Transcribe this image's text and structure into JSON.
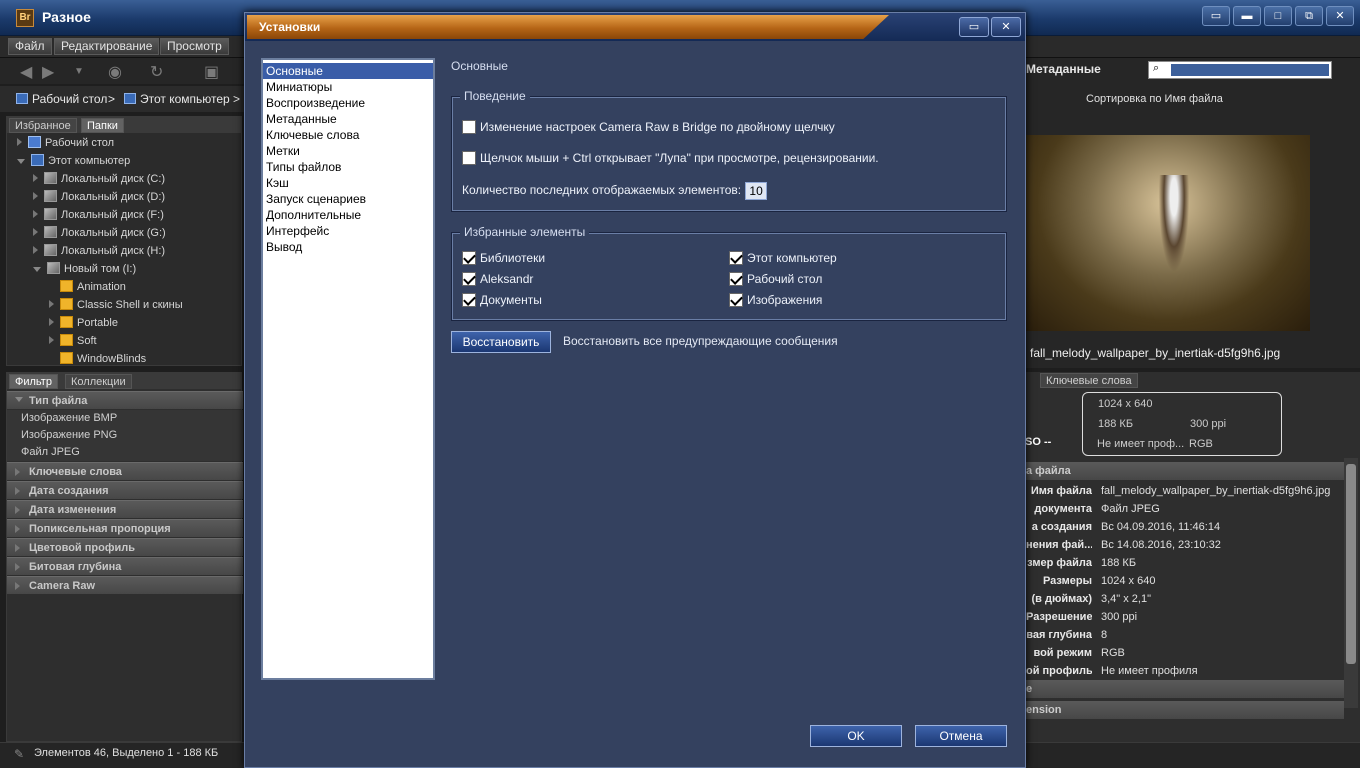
{
  "app": {
    "title": "Разное",
    "logo": "Br"
  },
  "window_controls": [
    "▭",
    "▬",
    "□",
    "⧉",
    "✕"
  ],
  "menu": [
    "Файл",
    "Редактирование",
    "Просмотр"
  ],
  "path": {
    "desktop": "Рабочий стол",
    "computer": "Этот компьютер"
  },
  "left_tabs": {
    "favorites": "Избранное",
    "folders": "Папки"
  },
  "tree": [
    {
      "label": "Рабочий стол"
    },
    {
      "label": "Этот компьютер"
    },
    {
      "label": "Локальный диск (C:)"
    },
    {
      "label": "Локальный диск (D:)"
    },
    {
      "label": "Локальный диск (F:)"
    },
    {
      "label": "Локальный диск (G:)"
    },
    {
      "label": "Локальный диск (H:)"
    },
    {
      "label": "Новый том (I:)"
    },
    {
      "label": "Animation"
    },
    {
      "label": "Classic Shell и скины"
    },
    {
      "label": "Portable"
    },
    {
      "label": "Soft"
    },
    {
      "label": "WindowBlinds"
    }
  ],
  "filter_tabs": {
    "filter": "Фильтр",
    "collections": "Коллекции"
  },
  "filters": {
    "file_type": "Тип файла",
    "file_type_items": [
      "Изображение BMP",
      "Изображение PNG",
      "Файл JPEG"
    ],
    "groups": [
      "Ключевые слова",
      "Дата создания",
      "Дата изменения",
      "Попиксельная пропорция",
      "Цветовой профиль",
      "Битовая глубина",
      "Camera Raw"
    ]
  },
  "status": "Элементов 46, Выделено 1 - 188 КБ",
  "right": {
    "metadata_label": "Метаданные",
    "sort_label": "Сортировка по Имя файла",
    "thumb_caption": "fall_melody_wallpaper_by_inertiak-d5fg9h6.jpg",
    "tab_keywords": "Ключевые слова",
    "card": {
      "dims": "1024 x 640",
      "size": "188 КБ",
      "ppi": "300 ppi",
      "profile": "Не имеет проф...",
      "mode": "RGB",
      "iso": "ISO --"
    },
    "section_file": "а файла",
    "rows": [
      {
        "k": "Имя файла",
        "v": "fall_melody_wallpaper_by_inertiak-d5fg9h6.jpg"
      },
      {
        "k": "документа",
        "v": "Файл JPEG"
      },
      {
        "k": "а создания",
        "v": "Вс 04.09.2016, 11:46:14"
      },
      {
        "k": "нения фай...",
        "v": "Вс 14.08.2016, 23:10:32"
      },
      {
        "k": "змер файла",
        "v": "188 КБ"
      },
      {
        "k": "Размеры",
        "v": "1024 x 640"
      },
      {
        "k": "(в дюймах)",
        "v": "3,4\" x 2,1\""
      },
      {
        "k": "Разрешение",
        "v": "300 ppi"
      },
      {
        "k": "вая глубина",
        "v": "8"
      },
      {
        "k": "вой режим",
        "v": "RGB"
      },
      {
        "k": "ой профиль",
        "v": "Не имеет профиля"
      }
    ],
    "section_e": "e",
    "section_ension": "ension"
  },
  "dialog": {
    "title": "Установки",
    "btn_restore": "▭",
    "btn_close": "✕",
    "categories": [
      "Основные",
      "Миниатюры",
      "Воспроизведение",
      "Метаданные",
      "Ключевые слова",
      "Метки",
      "Типы файлов",
      "Кэш",
      "Запуск сценариев",
      "Дополнительные",
      "Интерфейс",
      "Вывод"
    ],
    "section": "Основные",
    "behavior": {
      "legend": "Поведение",
      "opt1": "Изменение настроек Camera Raw в Bridge по двойному щелчку",
      "opt2": "Щелчок мыши + Ctrl открывает \"Лупа\" при просмотре, рецензировании.",
      "recent_label": "Количество последних отображаемых элементов:",
      "recent_value": "10"
    },
    "favorites": {
      "legend": "Избранные элементы",
      "items": [
        "Библиотеки",
        "Aleksandr",
        "Документы",
        "Этот компьютер",
        "Рабочий стол",
        "Изображения"
      ]
    },
    "restore_button": "Восстановить",
    "restore_msg": "Восстановить все предупреждающие сообщения",
    "ok": "OK",
    "cancel": "Отмена"
  }
}
